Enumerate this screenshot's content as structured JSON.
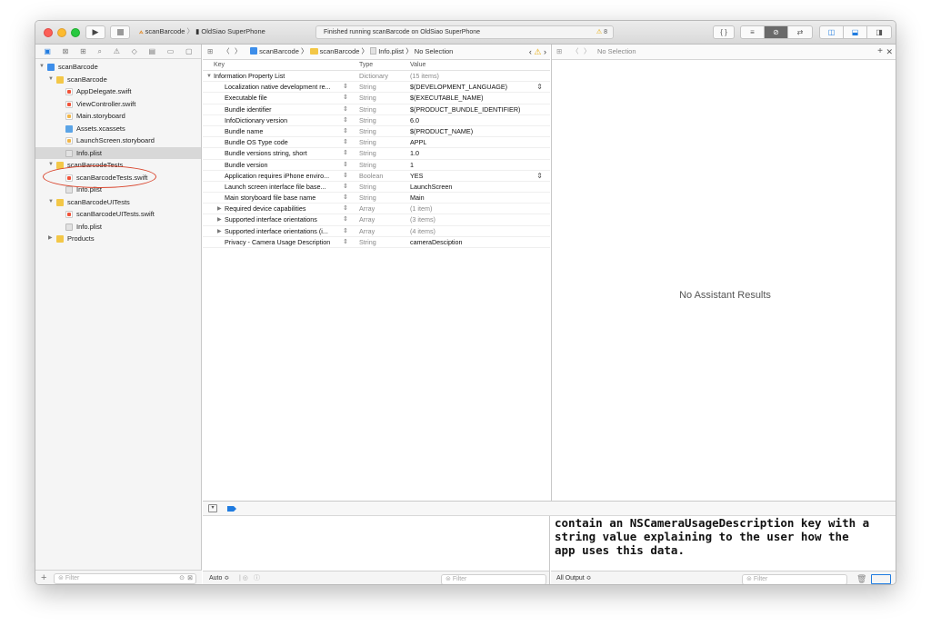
{
  "toolbar": {
    "scheme_name": "scanBarcode",
    "device_name": "OldSiao SuperPhone",
    "status_text": "Finished running scanBarcode on OldSiao SuperPhone",
    "warning_count": "8"
  },
  "navigator": {
    "items": [
      {
        "label": "scanBarcode",
        "icon": "project-icon"
      },
      {
        "label": "scanBarcode",
        "icon": "folder-icon"
      },
      {
        "label": "AppDelegate.swift",
        "icon": "swift-file-icon"
      },
      {
        "label": "ViewController.swift",
        "icon": "swift-file-icon"
      },
      {
        "label": "Main.storyboard",
        "icon": "storyboard-file-icon"
      },
      {
        "label": "Assets.xcassets",
        "icon": "assets-icon"
      },
      {
        "label": "LaunchScreen.storyboard",
        "icon": "storyboard-file-icon"
      },
      {
        "label": "Info.plist",
        "icon": "plist-file-icon",
        "selected": true
      },
      {
        "label": "scanBarcodeTests",
        "icon": "folder-icon"
      },
      {
        "label": "scanBarcodeTests.swift",
        "icon": "swift-file-icon"
      },
      {
        "label": "Info.plist",
        "icon": "plist-file-icon"
      },
      {
        "label": "scanBarcodeUITests",
        "icon": "folder-icon"
      },
      {
        "label": "scanBarcodeUITests.swift",
        "icon": "swift-file-icon"
      },
      {
        "label": "Info.plist",
        "icon": "plist-file-icon"
      },
      {
        "label": "Products",
        "icon": "folder-icon"
      }
    ],
    "filter_placeholder": "Filter"
  },
  "jumpbar": {
    "project": "scanBarcode",
    "group": "scanBarcode",
    "file": "Info.plist",
    "selection": "No Selection"
  },
  "plist": {
    "headers": {
      "key": "Key",
      "type": "Type",
      "value": "Value"
    },
    "rows": [
      {
        "key": "Information Property List",
        "type": "Dictionary",
        "value": "(15 items)"
      },
      {
        "key": "Localization native development re...",
        "type": "String",
        "value": "$(DEVELOPMENT_LANGUAGE)"
      },
      {
        "key": "Executable file",
        "type": "String",
        "value": "$(EXECUTABLE_NAME)"
      },
      {
        "key": "Bundle identifier",
        "type": "String",
        "value": "$(PRODUCT_BUNDLE_IDENTIFIER)"
      },
      {
        "key": "InfoDictionary version",
        "type": "String",
        "value": "6.0"
      },
      {
        "key": "Bundle name",
        "type": "String",
        "value": "$(PRODUCT_NAME)"
      },
      {
        "key": "Bundle OS Type code",
        "type": "String",
        "value": "APPL"
      },
      {
        "key": "Bundle versions string, short",
        "type": "String",
        "value": "1.0"
      },
      {
        "key": "Bundle version",
        "type": "String",
        "value": "1"
      },
      {
        "key": "Application requires iPhone enviro...",
        "type": "Boolean",
        "value": "YES"
      },
      {
        "key": "Launch screen interface file base...",
        "type": "String",
        "value": "LaunchScreen"
      },
      {
        "key": "Main storyboard file base name",
        "type": "String",
        "value": "Main"
      },
      {
        "key": "Required device capabilities",
        "type": "Array",
        "value": "(1 item)"
      },
      {
        "key": "Supported interface orientations",
        "type": "Array",
        "value": "(3 items)"
      },
      {
        "key": "Supported interface orientations (i...",
        "type": "Array",
        "value": "(4 items)"
      },
      {
        "key": "Privacy - Camera Usage Description",
        "type": "String",
        "value": "cameraDesciption"
      }
    ]
  },
  "assistant": {
    "jump_selection": "No Selection",
    "empty_message": "No Assistant Results"
  },
  "console": {
    "lines": [
      "contain an NSCameraUsageDescription key with a",
      "string value explaining to the user how the",
      "app uses this data."
    ],
    "output_selector": "All Output ≎",
    "filter_placeholder": "Filter"
  },
  "variables": {
    "mode_selector": "Auto ≎",
    "filter_placeholder": "Filter"
  }
}
